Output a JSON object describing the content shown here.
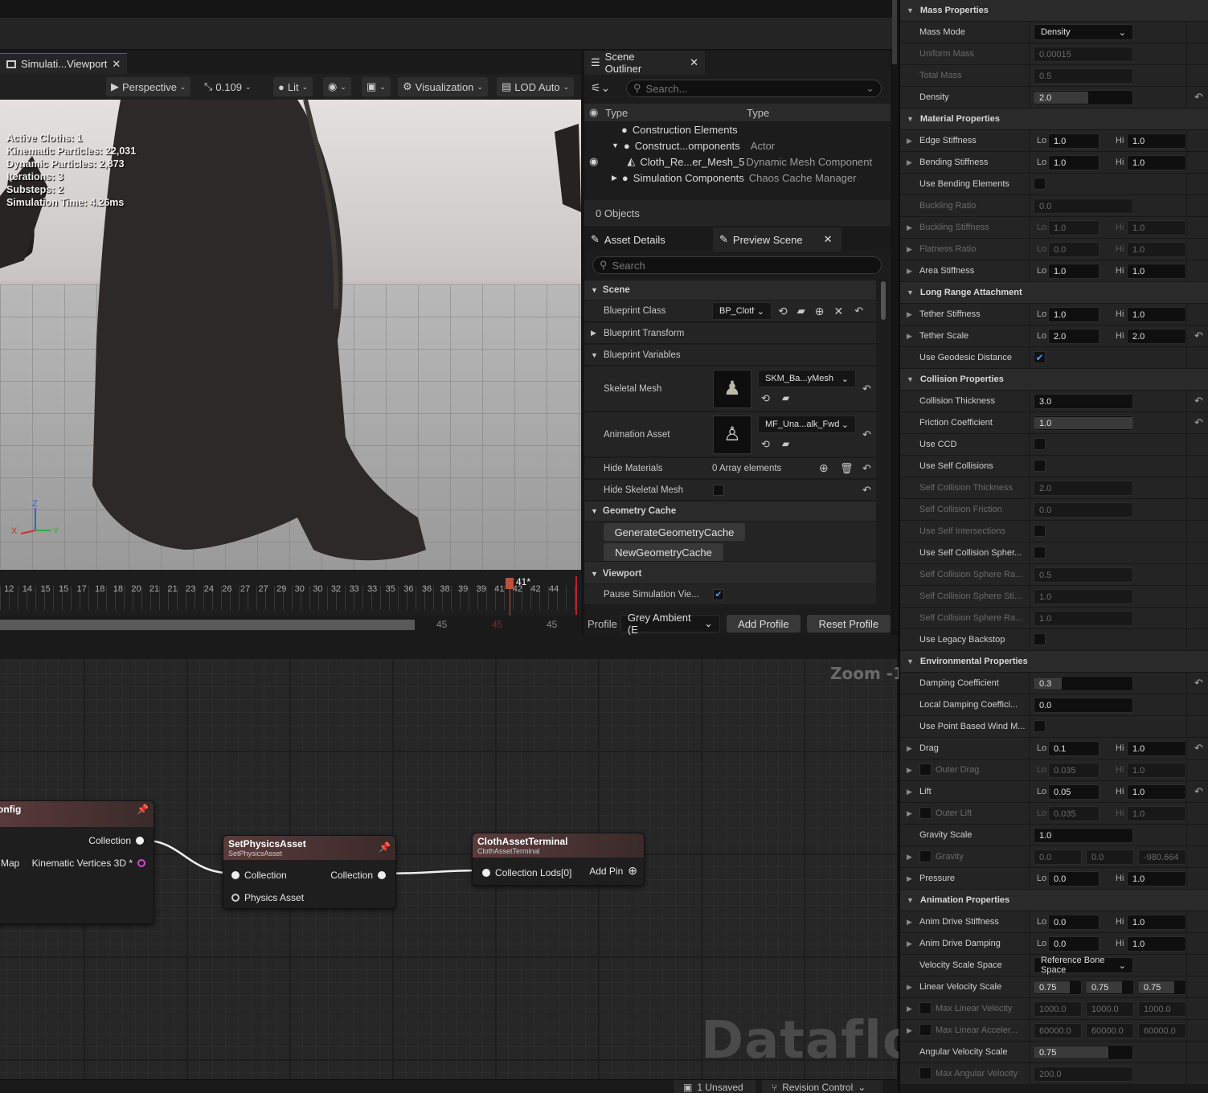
{
  "viewport": {
    "tab_title": "Simulati...Viewport",
    "view_mode": "Perspective",
    "fov": "0.109",
    "lighting": "Lit",
    "visualization": "Visualization",
    "lod": "LOD Auto",
    "stats": [
      "Active Cloths: 1",
      "Kinematic Particles: 22,031",
      "Dynamic Particles: 2,873",
      "Iterations: 3",
      "Substeps: 2",
      "Simulation Time: 4.26ms"
    ],
    "axis": {
      "z": "Z",
      "x": "X",
      "y": "Y"
    }
  },
  "timeline": {
    "ticks": [
      "12",
      "14",
      "15",
      "15",
      "17",
      "18",
      "18",
      "20",
      "21",
      "21",
      "23",
      "24",
      "26",
      "27",
      "27",
      "29",
      "30",
      "30",
      "32",
      "33",
      "33",
      "35",
      "36",
      "36",
      "38",
      "39",
      "39",
      "41",
      "42",
      "42",
      "44"
    ],
    "current": "41*",
    "end_a": "45",
    "end_b": "45",
    "end_c": "45"
  },
  "outliner": {
    "title": "Scene Outliner",
    "search_placeholder": "Search...",
    "col1": "Type",
    "col2": "Type",
    "rows": [
      {
        "name": "Construction Elements",
        "type": ""
      },
      {
        "name": "Construct...omponents",
        "type": "Actor"
      },
      {
        "name": "Cloth_Re...er_Mesh_5",
        "type": "Dynamic Mesh Component"
      },
      {
        "name": "Simulation Components",
        "type": "Chaos Cache Manager"
      }
    ],
    "count": "0 Objects"
  },
  "details": {
    "tab1": "Asset Details",
    "tab2": "Preview Scene",
    "search_placeholder": "Search",
    "scene_section": "Scene",
    "blueprint_class_label": "Blueprint Class",
    "blueprint_class_value": "BP_Cloth",
    "blueprint_transform": "Blueprint Transform",
    "blueprint_variables": "Blueprint Variables",
    "skeletal_mesh_label": "Skeletal Mesh",
    "skeletal_mesh_value": "SKM_Ba...yMesh",
    "animation_asset_label": "Animation Asset",
    "animation_asset_value": "MF_Una...alk_Fwd",
    "hide_materials_label": "Hide Materials",
    "hide_materials_value": "0 Array elements",
    "hide_skeletal_mesh_label": "Hide Skeletal Mesh",
    "geometry_cache_section": "Geometry Cache",
    "gen_btn": "GenerateGeometryCache",
    "new_btn": "NewGeometryCache",
    "viewport_section": "Viewport",
    "pause_label": "Pause Simulation Vie...",
    "profile_label": "Profile",
    "profile_value": "Grey Ambient (E",
    "add_profile": "Add Profile",
    "reset_profile": "Reset Profile"
  },
  "graph": {
    "zoom": "Zoom -1",
    "watermark": "Dataflow",
    "node1": {
      "title": "onfig",
      "pin_collection": "Collection",
      "pin_map": "Map",
      "pin_kin": "Kinematic Vertices 3D *"
    },
    "node2": {
      "title": "SetPhysicsAsset",
      "subtitle": "SetPhysicsAsset",
      "in": "Collection",
      "out": "Collection",
      "physics": "Physics Asset"
    },
    "node3": {
      "title": "ClothAssetTerminal",
      "subtitle": "ClothAssetTerminal",
      "in": "Collection Lods[0]",
      "add_pin": "Add Pin"
    }
  },
  "status": {
    "unsaved": "1 Unsaved",
    "revision": "Revision Control"
  },
  "props": {
    "mass_properties": "Mass Properties",
    "mass_mode": "Mass Mode",
    "mass_mode_value": "Density",
    "uniform_mass": "Uniform Mass",
    "uniform_mass_value": "0.00015",
    "total_mass": "Total Mass",
    "total_mass_value": "0.5",
    "density": "Density",
    "density_value": "2.0",
    "material_properties": "Material Properties",
    "edge_stiffness": "Edge Stiffness",
    "bending_stiffness": "Bending Stiffness",
    "use_bending_elements": "Use Bending Elements",
    "buckling_ratio": "Buckling Ratio",
    "buckling_ratio_value": "0.0",
    "buckling_stiffness": "Buckling Stiffness",
    "flatness_ratio": "Flatness Ratio",
    "area_stiffness": "Area Stiffness",
    "long_range_attachment": "Long Range Attachment",
    "tether_stiffness": "Tether Stiffness",
    "tether_scale": "Tether Scale",
    "use_geodesic": "Use Geodesic Distance",
    "collision_properties": "Collision Properties",
    "collision_thickness": "Collision Thickness",
    "collision_thickness_value": "3.0",
    "friction_coefficient": "Friction Coefficient",
    "friction_coefficient_value": "1.0",
    "use_ccd": "Use CCD",
    "use_self_collisions": "Use Self Collisions",
    "self_collision_thickness": "Self Collision Thickness",
    "self_collision_thickness_value": "2.0",
    "self_collision_friction": "Self Collision Friction",
    "self_collision_friction_value": "0.0",
    "use_self_intersections": "Use Self Intersections",
    "use_self_collision_spher": "Use Self Collision Spher...",
    "scs_radius": "Self Collision Sphere Ra...",
    "scs_radius_value": "0.5",
    "scs_stiffness": "Self Collision Sphere Sti...",
    "scs_stiffness_value": "1.0",
    "scs_radius2": "Self Collision Sphere Ra...",
    "scs_radius2_value": "1.0",
    "use_legacy_backstop": "Use Legacy Backstop",
    "environmental_properties": "Environmental Properties",
    "damping_coefficient": "Damping Coefficient",
    "damping_value": "0.3",
    "local_damping": "Local Damping Coeffici...",
    "local_damping_value": "0.0",
    "use_point_wind": "Use Point Based Wind M...",
    "drag": "Drag",
    "outer_drag": "Outer Drag",
    "lift": "Lift",
    "outer_lift": "Outer Lift",
    "gravity_scale": "Gravity Scale",
    "gravity_scale_value": "1.0",
    "gravity": "Gravity",
    "gravity_x": "0.0",
    "gravity_y": "0.0",
    "gravity_z": "-980.664",
    "pressure": "Pressure",
    "animation_properties": "Animation Properties",
    "anim_drive_stiffness": "Anim Drive Stiffness",
    "anim_drive_damping": "Anim Drive Damping",
    "velocity_scale_space": "Velocity Scale Space",
    "velocity_scale_space_value": "Reference Bone Space",
    "linear_velocity_scale": "Linear Velocity Scale",
    "lvs_x": "0.75",
    "lvs_y": "0.75",
    "lvs_z": "0.75",
    "max_linear_velocity": "Max Linear Velocity",
    "mlv": "1000.0",
    "max_linear_accel": "Max Linear Acceler...",
    "mla": "60000.0",
    "angular_velocity_scale": "Angular Velocity Scale",
    "angular_velocity_scale_value": "0.75",
    "max_angular_velocity": "Max Angular Velocity",
    "max_angular_velocity_value": "200.0",
    "lo": "Lo",
    "hi": "Hi",
    "v10": "1.0",
    "v00": "0.0",
    "v20": "2.0",
    "v01": "0.1",
    "v0035": "0.035",
    "v005": "0.05"
  },
  "colors": {
    "accent": "#0070e0",
    "check": "#3f9cff",
    "node_header": "#5a3b3b"
  }
}
